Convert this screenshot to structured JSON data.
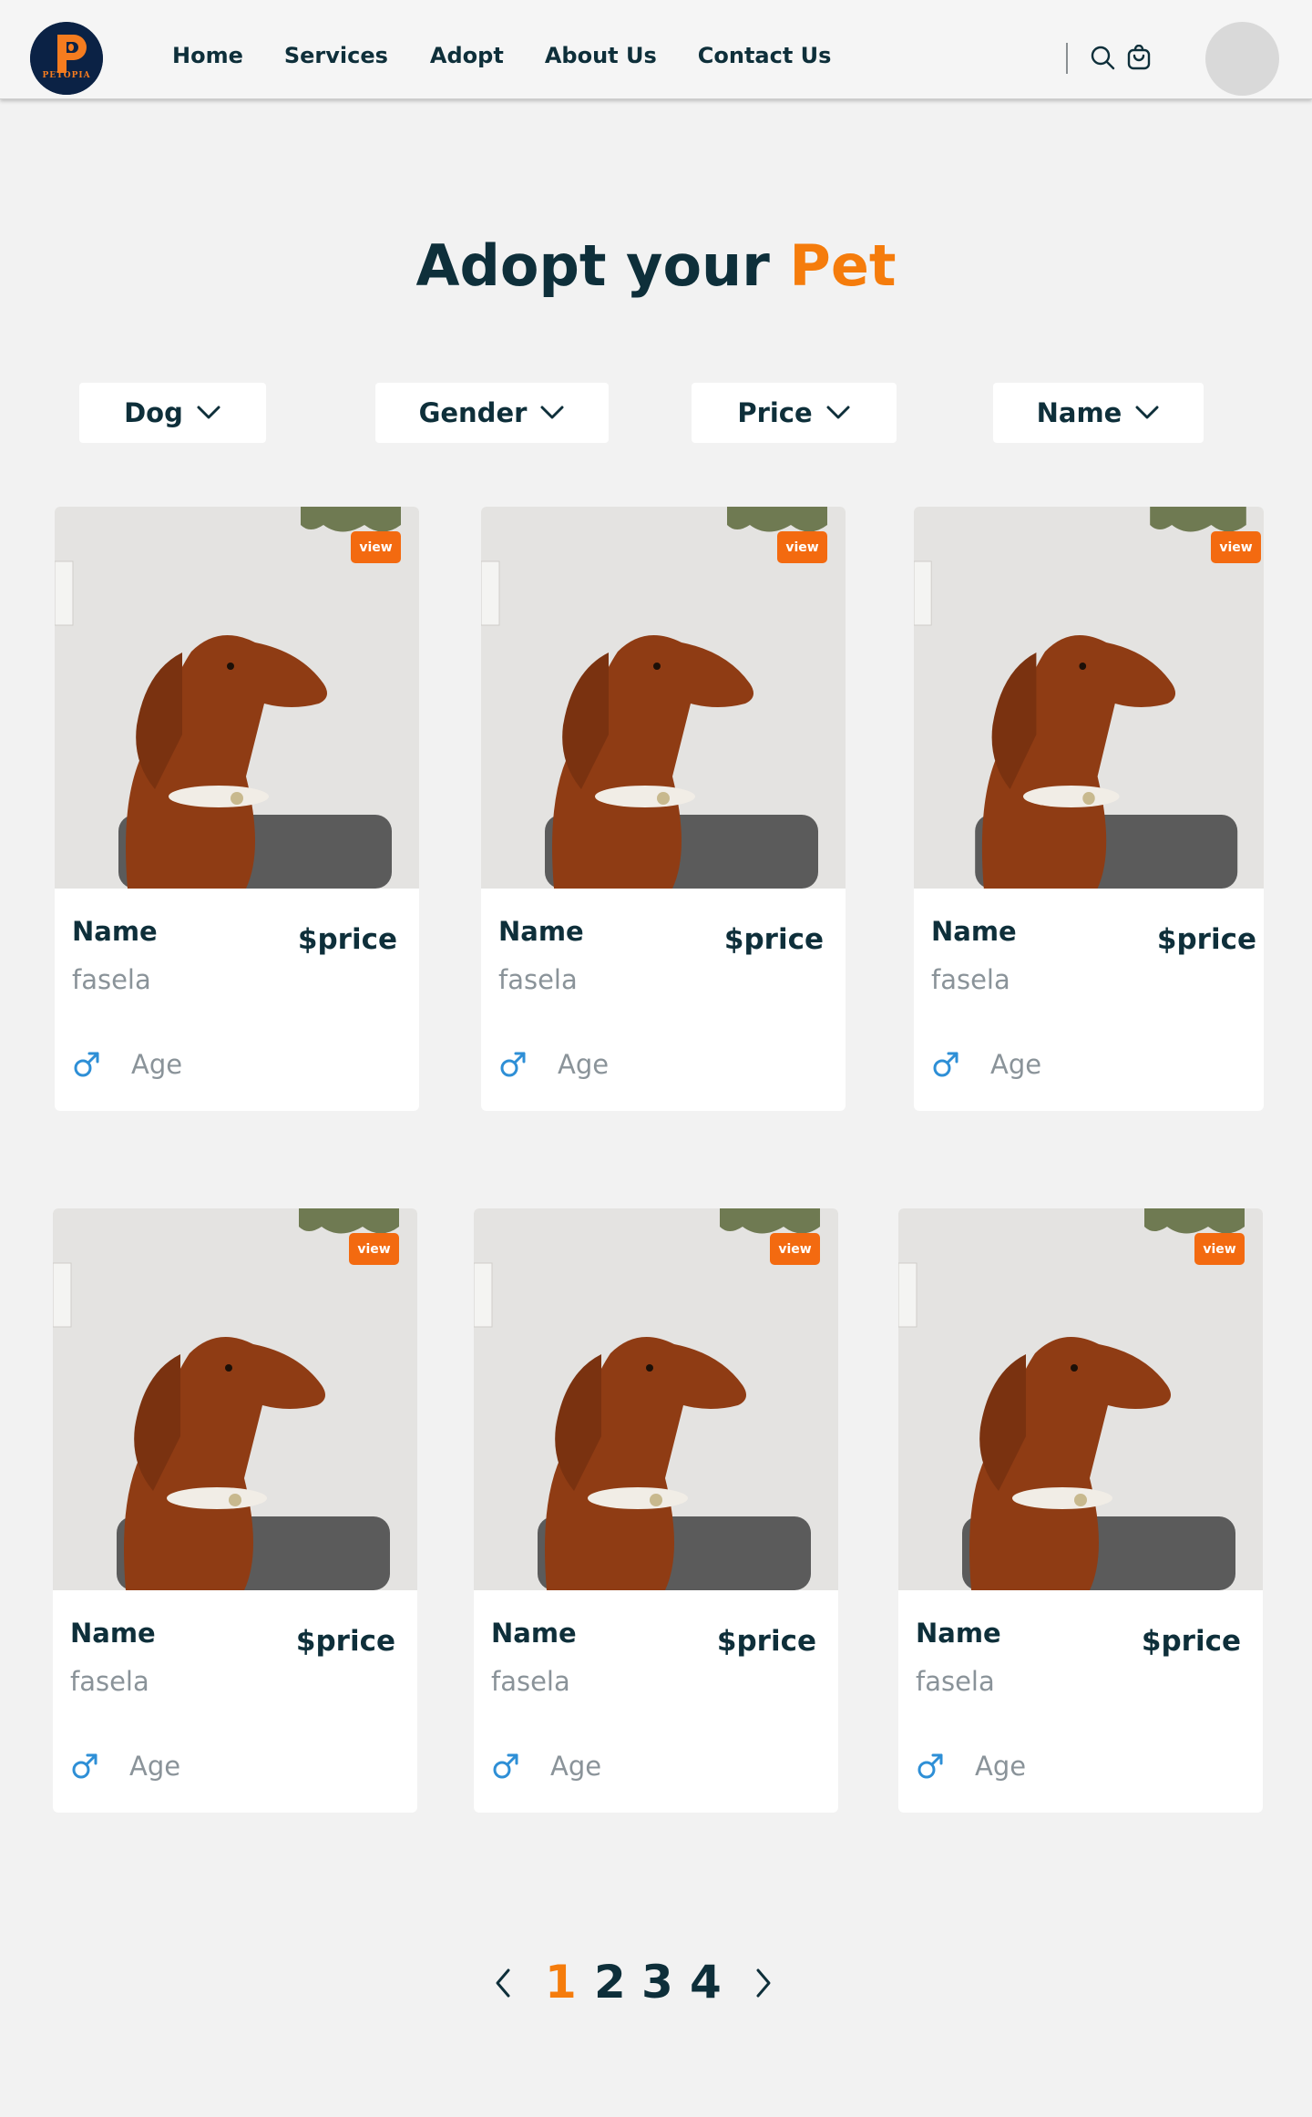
{
  "header": {
    "logo_text": "PETOPIA",
    "nav": [
      "Home",
      "Services",
      "Adopt",
      "About Us",
      "Contact Us"
    ],
    "icons": [
      "search-icon",
      "cart-icon"
    ]
  },
  "title": {
    "prefix": "Adopt your",
    "accent": "Pet"
  },
  "filters": [
    "Dog",
    "Gender",
    "Price",
    "Name"
  ],
  "pets": [
    {
      "view": "view",
      "name": "Name",
      "price": "$price",
      "breed": "fasela",
      "gender": "male-icon",
      "age": "Age"
    },
    {
      "view": "view",
      "name": "Name",
      "price": "$price",
      "breed": "fasela",
      "gender": "male-icon",
      "age": "Age"
    },
    {
      "view": "view",
      "name": "Name",
      "price": "$price",
      "breed": "fasela",
      "gender": "male-icon",
      "age": "Age"
    },
    {
      "view": "view",
      "name": "Name",
      "price": "$price",
      "breed": "fasela",
      "gender": "male-icon",
      "age": "Age"
    },
    {
      "view": "view",
      "name": "Name",
      "price": "$price",
      "breed": "fasela",
      "gender": "male-icon",
      "age": "Age"
    },
    {
      "view": "view",
      "name": "Name",
      "price": "$price",
      "breed": "fasela",
      "gender": "male-icon",
      "age": "Age"
    }
  ],
  "pagination": {
    "pages": [
      "1",
      "2",
      "3",
      "4"
    ],
    "current": "1"
  },
  "colors": {
    "accent": "#f57c0c",
    "text_dark": "#0e2f3a",
    "muted": "#8a9399",
    "male": "#2e8fd6",
    "badge": "#f36a10"
  }
}
